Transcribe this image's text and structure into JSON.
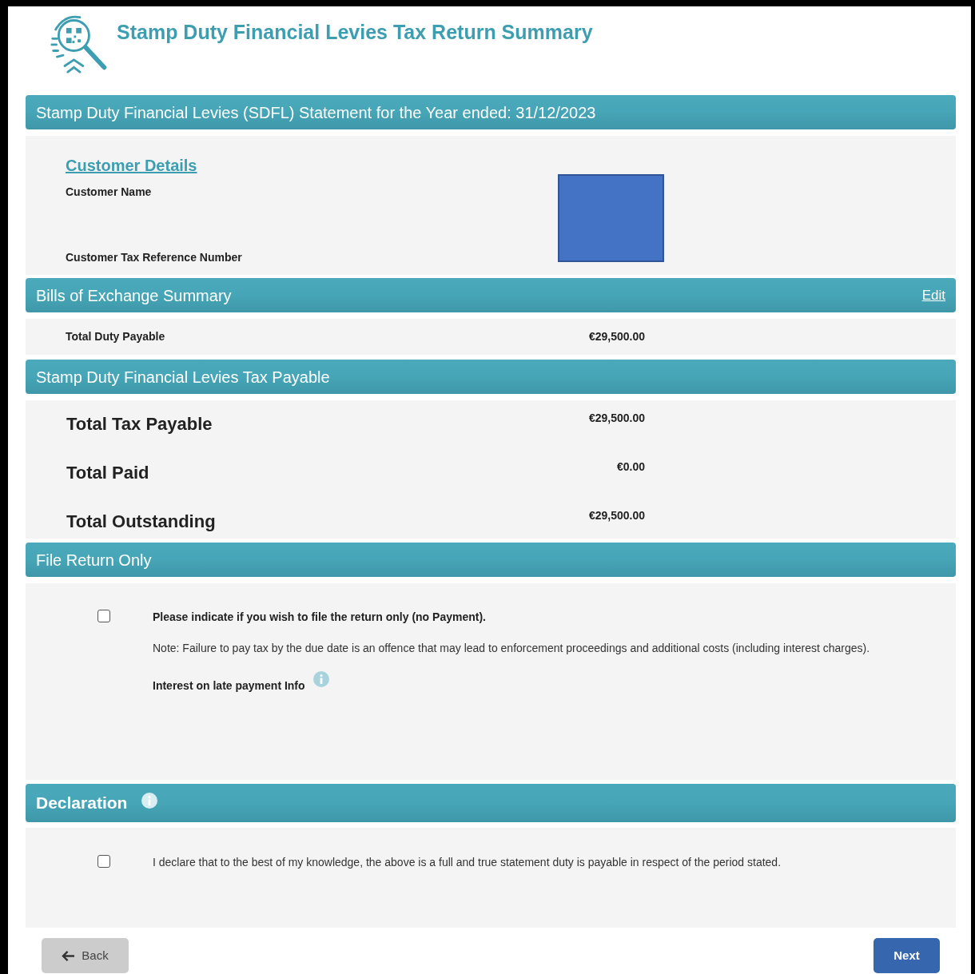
{
  "header": {
    "title": "Stamp Duty Financial Levies Tax Return Summary"
  },
  "statement_bar": {
    "title": "Stamp Duty Financial Levies (SDFL) Statement for the Year ended: 31/12/2023"
  },
  "customer_details": {
    "heading": "Customer Details",
    "fields": [
      {
        "label": "Customer Name"
      },
      {
        "label": "Customer Tax Reference Number"
      }
    ]
  },
  "bills_summary": {
    "title": "Bills of Exchange Summary",
    "edit_link": "Edit",
    "rows": [
      {
        "label": "Total Duty Payable",
        "value": "€29,500.00"
      }
    ]
  },
  "tax_payable": {
    "title": "Stamp Duty Financial Levies Tax Payable",
    "rows": [
      {
        "label": "Total Tax Payable",
        "value": "€29,500.00"
      },
      {
        "label": "Total Paid",
        "value": "€0.00"
      },
      {
        "label": "Total Outstanding",
        "value": "€29,500.00"
      }
    ]
  },
  "file_return": {
    "title": "File Return Only",
    "checkbox": {
      "checked": false,
      "label": "Please indicate if you wish to file the return only (no Payment)."
    },
    "note": "Note: Failure to pay tax by the due date is an offence that may lead to enforcement proceedings and additional costs (including interest charges).",
    "info_label": "Interest on late payment Info"
  },
  "declaration": {
    "title": "Declaration",
    "checkbox": {
      "checked": false,
      "label": "I declare that to the best of my knowledge, the above is a full and true statement duty is payable in respect of the period stated."
    }
  },
  "buttons": {
    "back": "Back",
    "next": "Next"
  }
}
